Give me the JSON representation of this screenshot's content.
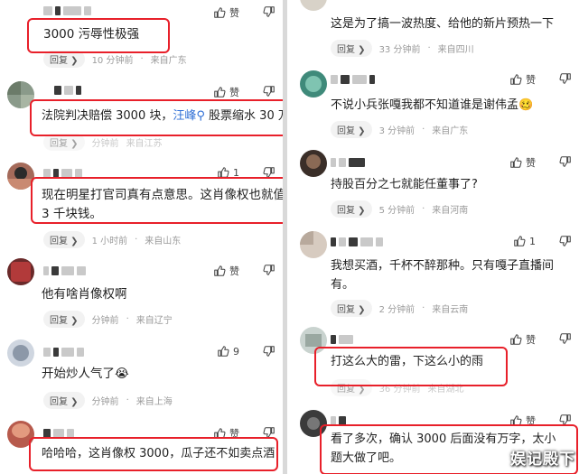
{
  "left": {
    "c1": {
      "text": "3000 污辱性极强",
      "reply": "回复",
      "time": "10 分钟前",
      "location": "来自广东",
      "like": "赞"
    },
    "c2": {
      "text_a": "法院判决赔偿 3000 块，",
      "text_link": "汪峰",
      "text_b": " 股票缩水 30 万",
      "reply": "回复",
      "time": "分钟前",
      "location": "来自江苏",
      "like": "赞"
    },
    "c3": {
      "text": "现在明星打官司真有点意思。这肖像权也就值 3 千块钱。",
      "reply": "回复",
      "time": "1 小时前",
      "location": "来自山东",
      "like": "1"
    },
    "c4": {
      "text": "他有啥肖像权啊",
      "reply": "回复",
      "time": "分钟前",
      "location": "来自辽宁",
      "like": "赞"
    },
    "c5": {
      "text": "开始炒人气了😭",
      "reply": "回复",
      "time": "分钟前",
      "location": "来自上海",
      "like": "9"
    },
    "c6": {
      "text": "哈哈哈，这肖像权 3000，瓜子还不如卖点酒",
      "like": "赞"
    }
  },
  "right": {
    "c1": {
      "text": "这是为了搞一波热度、给他的新片预热一下",
      "reply": "回复",
      "time": "33 分钟前",
      "location": "来自四川"
    },
    "c2": {
      "text": "不说小兵张嘎我都不知道谁是谢伟孟🥴",
      "reply": "回复",
      "time": "3 分钟前",
      "location": "来自广东",
      "like": "赞"
    },
    "c3": {
      "text": "持股百分之七就能任董事了?",
      "reply": "回复",
      "time": "5 分钟前",
      "location": "来自河南",
      "like": "赞"
    },
    "c4": {
      "text": "我想买酒，千杯不醉那种。只有嘎子直播间有。",
      "reply": "回复",
      "time": "2 分钟前",
      "location": "来自云南",
      "like": "1"
    },
    "c5": {
      "text": "打这么大的雷，下这么小的雨",
      "reply": "回复",
      "time": "36 分钟前",
      "location": "来自湖北",
      "like": "赞"
    },
    "c6": {
      "text": "看了多次，确认 3000 后面没有万字，太小题大做了吧。",
      "reply": "回复",
      "time": "",
      "location": "",
      "like": "赞"
    }
  },
  "watermark": "娱记殿下",
  "colors": {
    "highlight_box": "#e8202a",
    "link": "#2f6fd6",
    "meta": "#9a9a9a"
  }
}
